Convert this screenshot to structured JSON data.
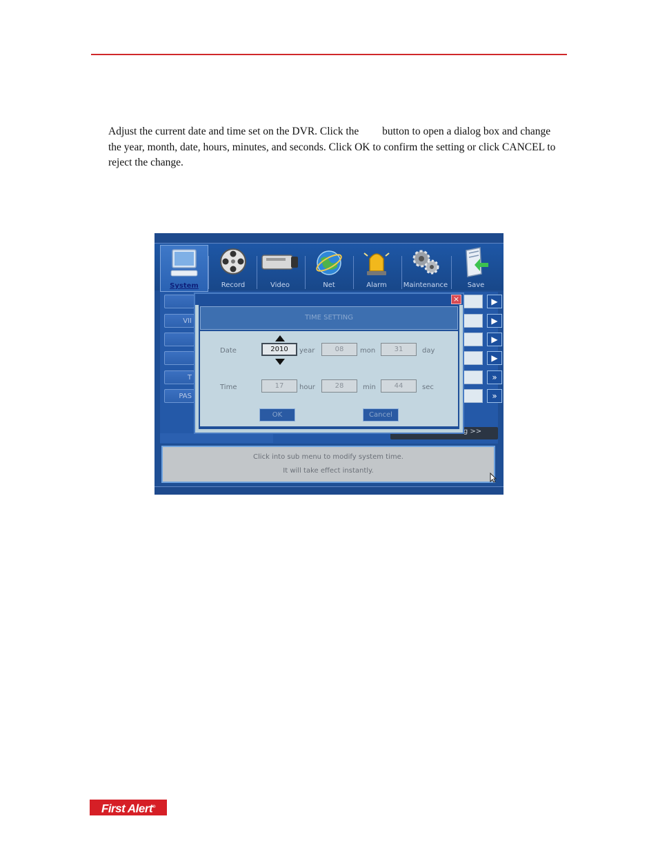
{
  "document": {
    "paragraph": {
      "part1": "Adjust the current date and time set on the DVR. Click the",
      "part2": "button to open a dialog box and change the year, month, date, hours, minutes, and seconds. Click OK to confirm the setting or click CANCEL to reject the change."
    },
    "logo_text": "First Alert",
    "logo_mark": "®"
  },
  "screenshot": {
    "tabs": [
      {
        "label": "System",
        "icon": "monitor-icon",
        "active": true
      },
      {
        "label": "Record",
        "icon": "film-reel-icon"
      },
      {
        "label": "Video",
        "icon": "camera-icon"
      },
      {
        "label": "Net",
        "icon": "globe-icon"
      },
      {
        "label": "Alarm",
        "icon": "siren-icon"
      },
      {
        "label": "Maintenance",
        "icon": "gears-icon"
      },
      {
        "label": "Save",
        "icon": "save-icon"
      }
    ],
    "sidebar": [
      "",
      "VII",
      "",
      "",
      "T",
      "PAS"
    ],
    "row_buttons": [
      "▶",
      "▶",
      "▶",
      "▶",
      "»",
      "»"
    ],
    "advanced_setting": "Advanced Setting >>",
    "info": {
      "line1": "Click into sub menu to modify system time.",
      "line2": "It will take effect instantly."
    },
    "dialog": {
      "title": "TIME SETTING",
      "close": "×",
      "date_label": "Date",
      "time_label": "Time",
      "year": "2010",
      "year_unit": "year",
      "month": "08",
      "month_unit": "mon",
      "day": "31",
      "day_unit": "day",
      "hour": "17",
      "hour_unit": "hour",
      "minute": "28",
      "minute_unit": "min",
      "second": "44",
      "second_unit": "sec",
      "ok": "OK",
      "cancel": "Cancel"
    },
    "colors": {
      "accent_red": "#d0282a",
      "ui_blue": "#1f4f95",
      "dialog_bg": "#bcd2dc"
    }
  }
}
